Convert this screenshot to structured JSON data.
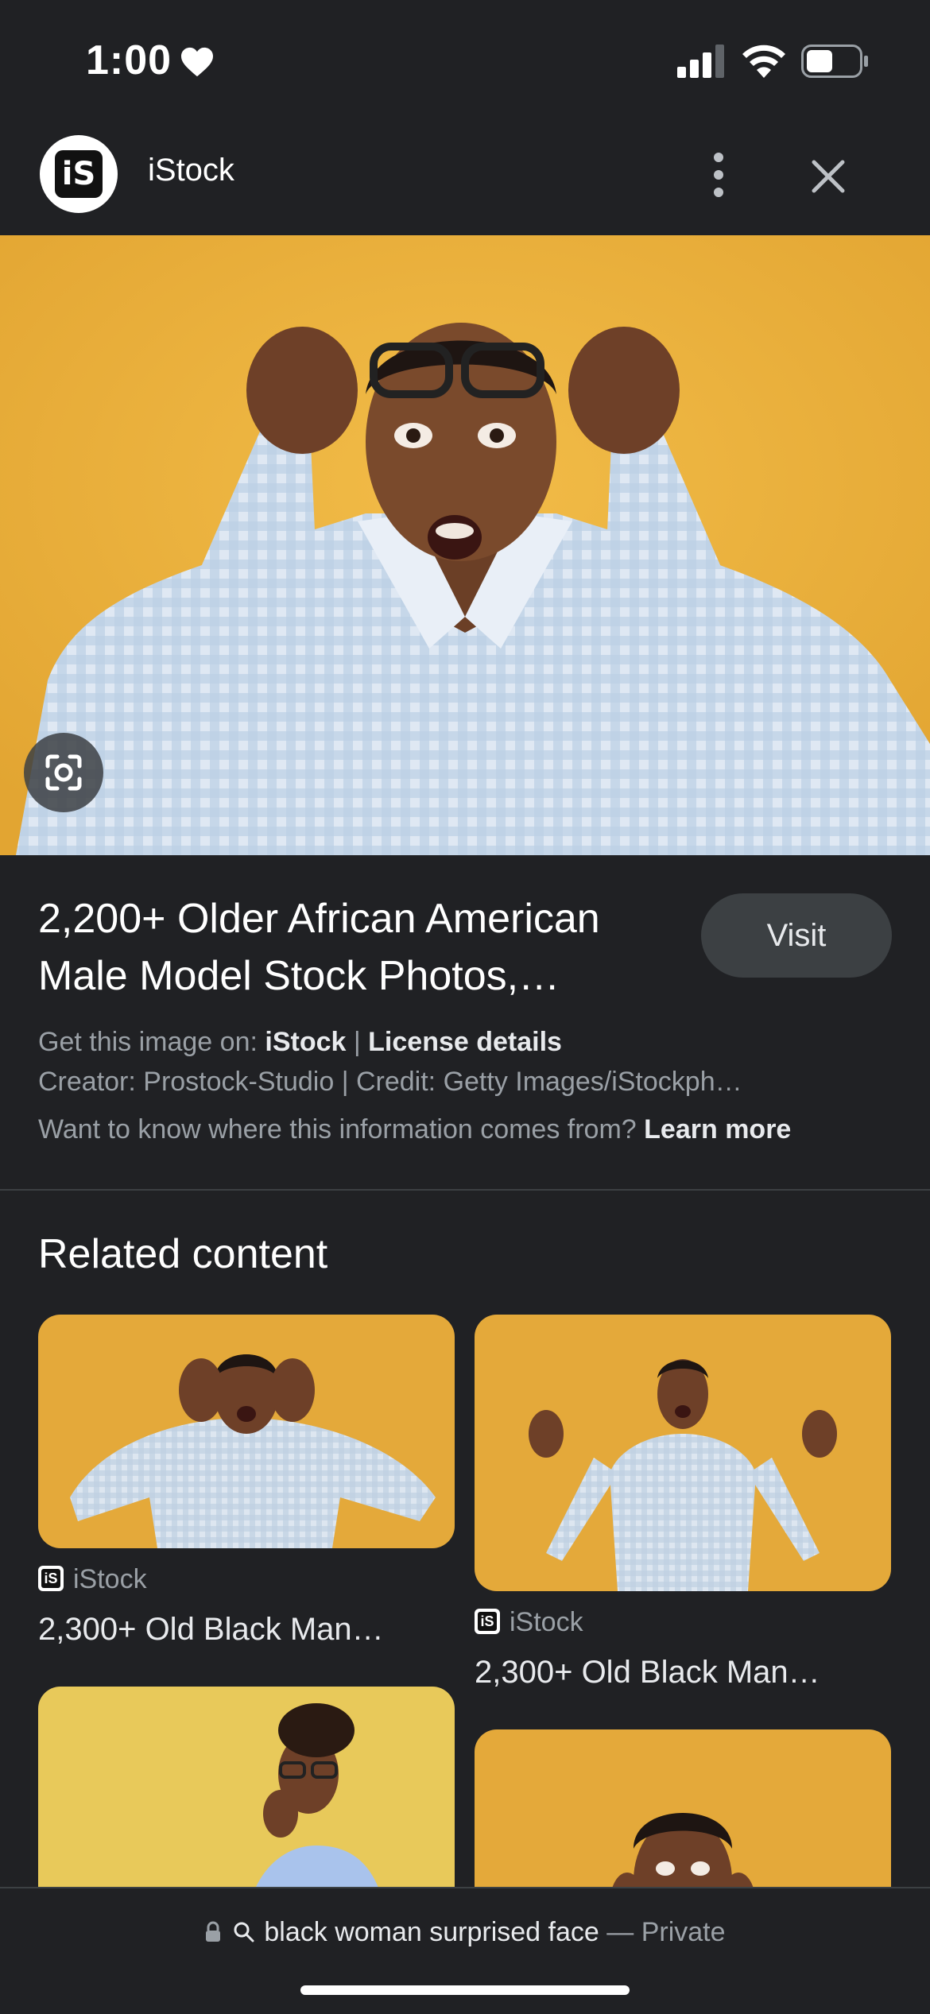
{
  "status_bar": {
    "time": "1:00",
    "icons": [
      "heart-icon",
      "cellular-signal-icon",
      "wifi-icon",
      "battery-icon"
    ]
  },
  "header": {
    "site_logo_text": "iS",
    "site_name": "iStock",
    "icons": [
      "more-vert-icon",
      "close-icon"
    ]
  },
  "hero": {
    "lens_icon": "google-lens-icon"
  },
  "info": {
    "title_line1": "2,200+ Older African American",
    "title_line2": "Male Model Stock Photos,…",
    "visit_label": "Visit",
    "get_image_prefix": "Get this image on: ",
    "get_image_site": "iStock",
    "separator": " | ",
    "license_label": "License details",
    "creator_line": "Creator: Prostock-Studio | Credit: Getty Images/iStockph…",
    "info_question": "Want to know where this information comes from? ",
    "learn_more": "Learn more"
  },
  "related": {
    "heading": "Related content",
    "cards": [
      {
        "source": "iStock",
        "title": "2,300+ Old Black Man…"
      },
      {
        "source": "iStock",
        "title": "2,300+ Old Black Man…"
      }
    ]
  },
  "bottom_bar": {
    "query": "black woman surprised face",
    "privacy": "— Private",
    "icons": [
      "lock-icon",
      "search-icon"
    ]
  },
  "colors": {
    "background": "#202124",
    "photo_backdrop": "#e7b03c",
    "visit_button": "#3c4043"
  }
}
